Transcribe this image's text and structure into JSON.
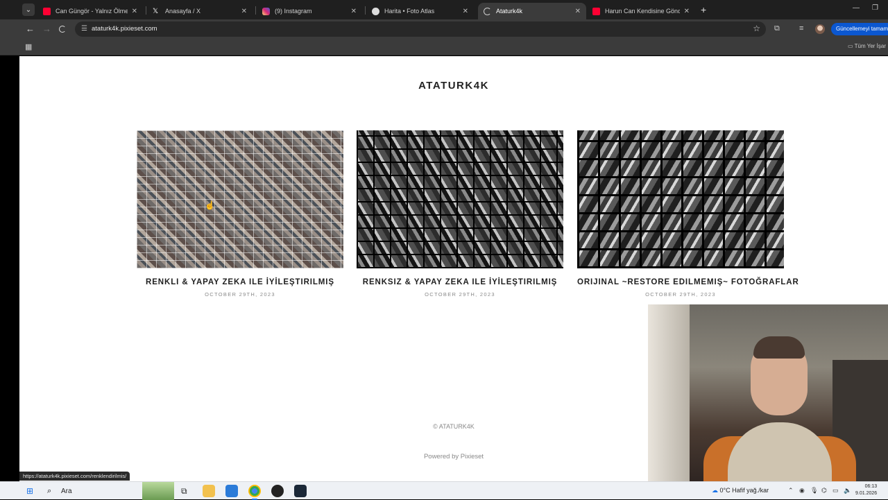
{
  "browser": {
    "tabs": [
      {
        "title": "Can Güngör - Yalnız Ölmek - Yo",
        "icon": "youtube-icon",
        "color": "#ff0033",
        "active": false
      },
      {
        "title": "Anasayfa / X",
        "icon": "x-icon",
        "color": "#ffffff",
        "active": false
      },
      {
        "title": "(9) Instagram",
        "icon": "instagram-icon",
        "color": "#d62976",
        "active": false
      },
      {
        "title": "Harita • Foto Atlas",
        "icon": "globe-icon",
        "color": "#dddddd",
        "active": false
      },
      {
        "title": "Ataturk4k",
        "icon": "loading-icon",
        "color": "#cccccc",
        "active": true
      },
      {
        "title": "Harun Can Kendisine Gönderm",
        "icon": "youtube-icon",
        "color": "#ff0033",
        "active": false
      }
    ],
    "url": "ataturk4k.pixieset.com",
    "update_button": "Güncellemeyi tamamla",
    "bookmarks_all": "Tüm Yer İşar",
    "status_url": "https://ataturk4k.pixieset.com/renklendirilmis/"
  },
  "site": {
    "title": "ATATURK4K",
    "galleries": [
      {
        "title": "RENKLI & YAPAY ZEKA ILE İYİLEŞTIRILMIŞ",
        "date": "OCTOBER 29TH, 2023",
        "style": "color"
      },
      {
        "title": "RENKSIZ & YAPAY ZEKA ILE İYİLEŞTIRILMIŞ",
        "date": "OCTOBER 29TH, 2023",
        "style": "bw"
      },
      {
        "title": "ORIJINAL ~RESTORE EDILMEMIŞ~ FOTOĞRAFLAR",
        "date": "OCTOBER 29TH, 2023",
        "style": "orig"
      }
    ],
    "footer_copy": "© ATATURK4K",
    "footer_powered": "Powered by Pixieset"
  },
  "taskbar": {
    "search_label": "Ara",
    "weather": "0°C  Hafif yağ./kar",
    "time": "06:13",
    "date": "9.01.2026"
  }
}
